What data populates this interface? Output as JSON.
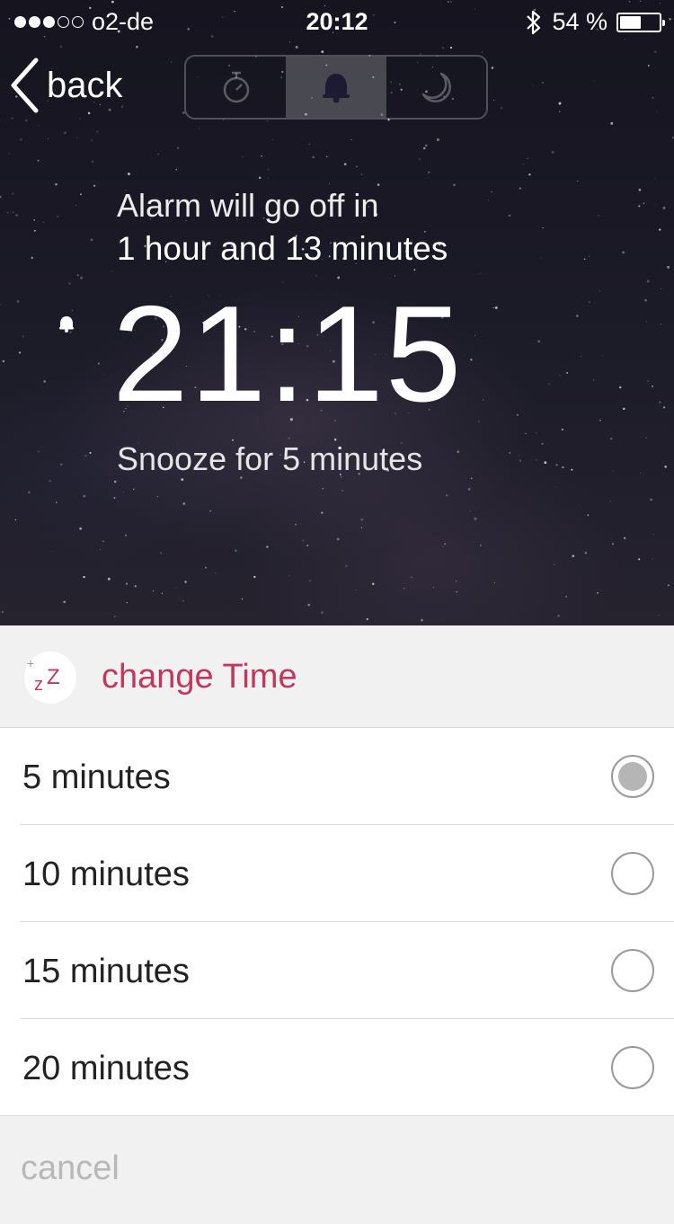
{
  "status_bar": {
    "carrier": "o2-de",
    "signal_bars_filled": 3,
    "signal_bars_total": 5,
    "time": "20:12",
    "battery_percent": "54 %",
    "battery_level": 0.54
  },
  "nav": {
    "back_label": "back",
    "segments": [
      {
        "icon": "stopwatch-icon",
        "active": false
      },
      {
        "icon": "bell-icon",
        "active": true
      },
      {
        "icon": "moon-icon",
        "active": false
      }
    ]
  },
  "alarm": {
    "line1": "Alarm will go off in",
    "line2": "1 hour and 13 minutes",
    "time": "21:15",
    "snooze_text": "Snooze for 5 minutes"
  },
  "sheet": {
    "icon": "snooze-zz-icon",
    "title": "change Time",
    "options": [
      {
        "label": "5 minutes",
        "selected": true
      },
      {
        "label": "10 minutes",
        "selected": false
      },
      {
        "label": "15 minutes",
        "selected": false
      },
      {
        "label": "20 minutes",
        "selected": false
      }
    ],
    "cancel_label": "cancel"
  },
  "colors": {
    "accent": "#c2375e",
    "cancel_text": "#b8b8b8"
  }
}
